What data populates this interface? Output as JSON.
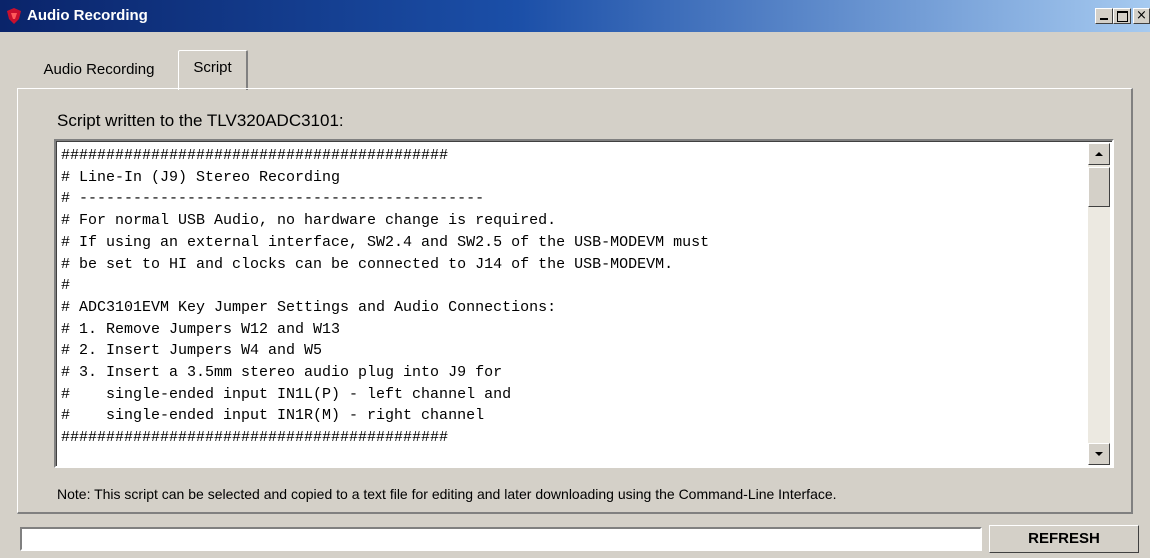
{
  "window": {
    "title": "Audio Recording",
    "icon": "ti-logo-icon",
    "controls": {
      "minimize": "minimize-icon",
      "maximize": "maximize-icon",
      "close": "×"
    }
  },
  "tabs": [
    {
      "label": "Audio Recording",
      "active": false
    },
    {
      "label": "Script",
      "active": true
    }
  ],
  "script_panel": {
    "label": "Script written to the TLV320ADC3101:",
    "lines": [
      "###########################################",
      "# Line-In (J9) Stereo Recording",
      "# ---------------------------------------------",
      "# For normal USB Audio, no hardware change is required.",
      "# If using an external interface, SW2.4 and SW2.5 of the USB-MODEVM must",
      "# be set to HI and clocks can be connected to J14 of the USB-MODEVM.",
      "#",
      "# ADC3101EVM Key Jumper Settings and Audio Connections:",
      "# 1. Remove Jumpers W12 and W13",
      "# 2. Insert Jumpers W4 and W5",
      "# 3. Insert a 3.5mm stereo audio plug into J9 for",
      "#    single-ended input IN1L(P) - left channel and",
      "#    single-ended input IN1R(M) - right channel",
      "###########################################"
    ]
  },
  "note": "Note: This script can be selected and copied to a text file for editing and later downloading using the Command-Line Interface.",
  "status_bar": {
    "value": "",
    "refresh_label": "REFRESH"
  },
  "colors": {
    "titlebar_start": "#0a246a",
    "titlebar_end": "#a6caf0",
    "window_bg": "#d4d0c8"
  }
}
